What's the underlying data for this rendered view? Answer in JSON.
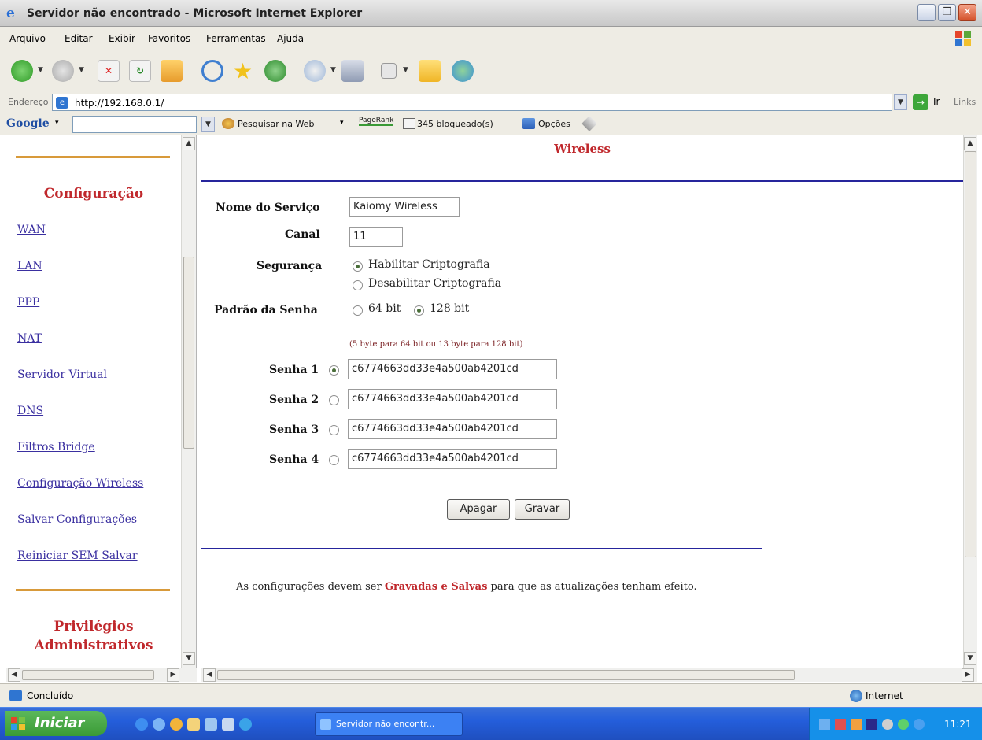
{
  "window": {
    "title": "Servidor não encontrado - Microsoft Internet Explorer",
    "controls": [
      "minimize",
      "maximize",
      "close"
    ]
  },
  "menubar": {
    "items": [
      "Arquivo",
      "Editar",
      "Exibir",
      "Favoritos",
      "Ferramentas",
      "Ajuda"
    ]
  },
  "toolbar": {
    "icons": [
      "back-icon",
      "forward-icon",
      "stop-icon",
      "refresh-icon",
      "home-icon",
      "search-icon",
      "favorites-icon",
      "history-icon",
      "mail-icon",
      "print-icon",
      "edit-icon",
      "folder-icon",
      "messenger-icon"
    ]
  },
  "address": {
    "label": "Endereço",
    "url": "http://192.168.0.1/",
    "go_label": "Ir",
    "links_label": "Links"
  },
  "googlebar": {
    "logo": "Google",
    "search_web_label": "Pesquisar na Web",
    "pagerank_label": "PageRank",
    "blocked_label": "345 bloqueado(s)",
    "options_label": "Opções"
  },
  "sidebar": {
    "section_title": "Configuração",
    "items": [
      {
        "label": "WAN"
      },
      {
        "label": "LAN"
      },
      {
        "label": "PPP"
      },
      {
        "label": "NAT"
      },
      {
        "label": "Servidor Virtual"
      },
      {
        "label": "DNS"
      },
      {
        "label": "Filtros Bridge"
      },
      {
        "label": "Configuração Wireless"
      },
      {
        "label": "Salvar Configurações"
      },
      {
        "label": "Reiniciar SEM Salvar"
      }
    ],
    "section2_line1": "Privilégios",
    "section2_line2": "Administrativos"
  },
  "main": {
    "page_title": "Wireless",
    "service_name_label": "Nome do Serviço",
    "service_name_value": "Kaiomy Wireless",
    "channel_label": "Canal",
    "channel_value": "11",
    "security_label": "Segurança",
    "security_options": [
      {
        "label": "Habilitar Criptografia",
        "selected": true
      },
      {
        "label": "Desabilitar Criptografia",
        "selected": false
      }
    ],
    "key_standard_label": "Padrão da Senha",
    "key_standard_options": [
      {
        "label": "64 bit",
        "selected": false
      },
      {
        "label": "128 bit",
        "selected": true
      }
    ],
    "hint": "(5 byte para 64 bit ou 13 byte para 128 bit)",
    "keys": [
      {
        "label": "Senha 1",
        "value": "c6774663dd33e4a500ab4201cd",
        "selected": true
      },
      {
        "label": "Senha 2",
        "value": "c6774663dd33e4a500ab4201cd",
        "selected": false
      },
      {
        "label": "Senha 3",
        "value": "c6774663dd33e4a500ab4201cd",
        "selected": false
      },
      {
        "label": "Senha 4",
        "value": "c6774663dd33e4a500ab4201cd",
        "selected": false
      }
    ],
    "clear_button": "Apagar",
    "save_button": "Gravar",
    "footer_pre": "As configurações devem ser",
    "footer_emph": "Gravadas e Salvas",
    "footer_post": "para que as atualizações tenham efeito."
  },
  "statusbar": {
    "status": "Concluído",
    "zone": "Internet"
  },
  "taskbar": {
    "start_label": "Iniciar",
    "task_label": "Servidor não encontr...",
    "clock": "11:21"
  },
  "colors": {
    "accent_red": "#c0282c",
    "link_blue": "#3a2fa0",
    "rule_blue": "#26259c",
    "rule_orange": "#d89a3a",
    "taskbar_blue": "#245edb"
  }
}
